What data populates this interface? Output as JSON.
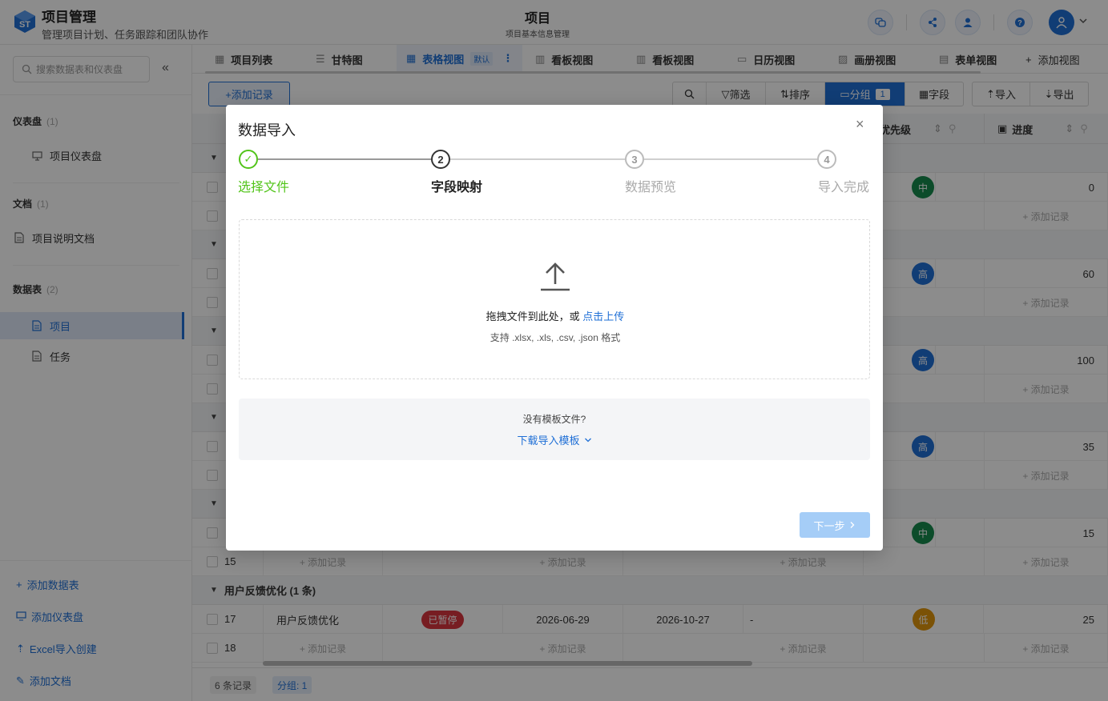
{
  "header": {
    "logo_text": "ST",
    "app_title": "项目管理",
    "app_subtitle": "管理项目计划、任务跟踪和团队协作",
    "page_title": "项目",
    "page_subtitle": "项目基本信息管理"
  },
  "sidebar": {
    "search_placeholder": "搜索数据表和仪表盘",
    "collapse_icon": "«",
    "sections": [
      {
        "title": "仪表盘",
        "count": "(1)",
        "items": [
          {
            "label": "项目仪表盘",
            "icon": "dashboard-icon"
          }
        ]
      },
      {
        "title": "文档",
        "count": "(1)",
        "items": [
          {
            "label": "项目说明文档",
            "icon": "document-icon"
          }
        ]
      },
      {
        "title": "数据表",
        "count": "(2)",
        "items": [
          {
            "label": "项目",
            "icon": "sheet-icon",
            "active": true
          },
          {
            "label": "任务",
            "icon": "sheet-icon"
          }
        ]
      }
    ],
    "bottom_links": [
      {
        "label": "添加数据表",
        "icon": "plus-icon"
      },
      {
        "label": "添加仪表盘",
        "icon": "dashboard-icon"
      },
      {
        "label": "Excel导入创建",
        "icon": "upload-icon"
      },
      {
        "label": "添加文档",
        "icon": "edit-icon"
      }
    ]
  },
  "tabs": [
    {
      "label": "项目列表",
      "icon": "grid-icon"
    },
    {
      "label": "甘特图",
      "icon": "gantt-icon"
    },
    {
      "label": "表格视图",
      "icon": "table-icon",
      "active": true,
      "badge": "默认"
    },
    {
      "label": "看板视图",
      "icon": "kanban-icon"
    },
    {
      "label": "看板视图",
      "icon": "kanban-icon"
    },
    {
      "label": "日历视图",
      "icon": "calendar-icon"
    },
    {
      "label": "画册视图",
      "icon": "gallery-icon"
    },
    {
      "label": "表单视图",
      "icon": "form-icon"
    }
  ],
  "add_view_label": "添加视图",
  "toolbar": {
    "add_record": "+添加记录",
    "filter": "筛选",
    "sort": "排序",
    "group": "分组",
    "group_count": "1",
    "fields": "字段",
    "import": "导入",
    "export": "导出"
  },
  "table": {
    "col_priority": "优先级",
    "col_progress": "进度",
    "add_record_cell": "+ 添加记录",
    "group_last": "用户反馈优化 (1 条)",
    "visible_rows": [
      {
        "prio": "中",
        "progress": "0"
      },
      {
        "prio": "高",
        "progress": "60"
      },
      {
        "prio": "高",
        "progress": "100"
      },
      {
        "prio": "高",
        "progress": "35"
      },
      {
        "prio": "中",
        "progress": "15"
      }
    ],
    "row15_num": "15",
    "row17": {
      "num": "17",
      "name": "用户反馈优化",
      "status": "已暂停",
      "start": "2026-06-29",
      "end": "2026-10-27",
      "owner": "-",
      "prio": "低",
      "progress": "25"
    },
    "row18_num": "18",
    "colors": {
      "status_paused": "#d9363e",
      "prio_high": "#1f6fd6",
      "prio_mid": "#168a4d",
      "prio_low": "#e0950c"
    }
  },
  "footer": {
    "records": "6 条记录",
    "groups": "分组: 1"
  },
  "modal": {
    "title": "数据导入",
    "close": "×",
    "steps": [
      {
        "num": "✓",
        "label": "选择文件",
        "state": "done"
      },
      {
        "num": "2",
        "label": "字段映射",
        "state": "current"
      },
      {
        "num": "3",
        "label": "数据预览",
        "state": "pending"
      },
      {
        "num": "4",
        "label": "导入完成",
        "state": "pending"
      }
    ],
    "drop_text": "拖拽文件到此处，或 ",
    "drop_link": "点击上传",
    "drop_hint": "支持 .xlsx, .xls, .csv, .json 格式",
    "template_question": "没有模板文件?",
    "template_link": "下载导入模板",
    "next_button": "下一步"
  }
}
